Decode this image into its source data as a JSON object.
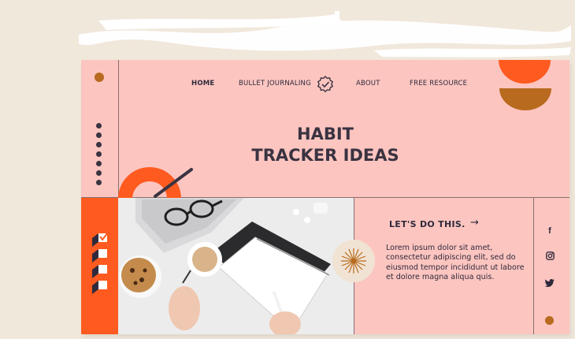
{
  "nav": {
    "home": "HOME",
    "bullet_journaling": "BULLET JOURNALING",
    "about": "ABOUT",
    "free_resource": "FREE RESOURCE",
    "logo_icon": "badge-check-icon"
  },
  "hero": {
    "title_line1": "HABIT",
    "title_line2": "TRACKER IDEAS"
  },
  "cta": {
    "label": "LET'S DO THIS.",
    "arrow": "→"
  },
  "body_text": "Lorem ipsum dolor sit amet, consectetur adipiscing elit, sed do eiusmod tempor incididunt ut labore et dolore magna aliqua quis.",
  "social": {
    "facebook": "f",
    "instagram_icon": "instagram-icon",
    "twitter_icon": "twitter-icon"
  },
  "colors": {
    "background": "#f1e8dc",
    "card": "#fcc5c0",
    "accent_orange": "#ff5a1f",
    "accent_brown": "#b86a1e",
    "text_dark": "#2f2a3b"
  }
}
